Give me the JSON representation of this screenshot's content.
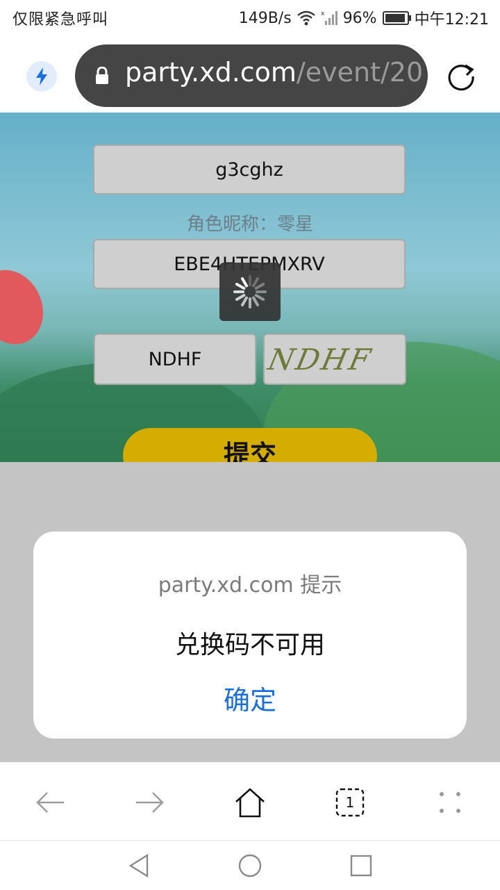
{
  "status": {
    "left_text": "仅限紧急呼叫",
    "speed": "149B/s",
    "battery": "96%",
    "battery_level": 0.96,
    "time": "中午12:21"
  },
  "browser": {
    "url_host": "party.xd.com",
    "url_path": "/event/20"
  },
  "form": {
    "account": "g3cghz",
    "nickname_label": "角色昵称：",
    "nickname": "零星",
    "redeem_code": "EBE4HTEPMXRV",
    "captcha_value": "NDHF",
    "captcha_image_text": "NDHF",
    "submit_label": "提交"
  },
  "dialog": {
    "title": "party.xd.com 提示",
    "message": "兑换码不可用",
    "ok_label": "确定"
  },
  "toolbar": {
    "tab_count": "1"
  },
  "colors": {
    "accent": "#1a6fe0",
    "submit": "#d4ad00",
    "url_pill": "#454545"
  }
}
